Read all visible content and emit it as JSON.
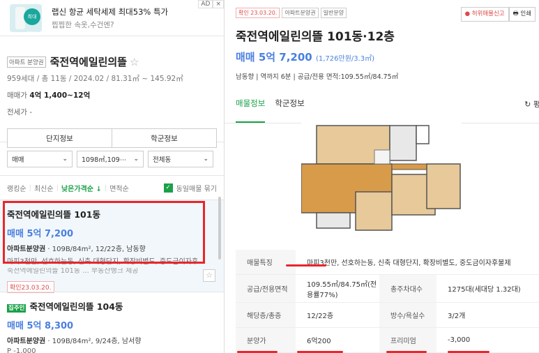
{
  "ad": {
    "title": "랩신 항균 세탁세제 최대53% 특가",
    "subtitle": "찝찝한 속옷,수건엔?",
    "badge": "최대53%",
    "ad_label": "AD",
    "close": "×"
  },
  "complex": {
    "tag": "아파트 분양권",
    "name": "죽전역에일린의뜰",
    "star": "☆",
    "meta": "959세대 / 총 11동 / 2024.02 / 81.31㎡ ~ 145.92㎡",
    "sale_label": "매매가",
    "sale_value": "4억 1,400~12억",
    "jeonse_label": "전세가",
    "jeonse_value": "-",
    "btn_complex": "단지정보",
    "btn_school": "학군정보"
  },
  "filters": {
    "type": "매매",
    "area": "1098㎡,109⋯",
    "dong": "전체동"
  },
  "sort": {
    "items": [
      "랭킹순",
      "최신순"
    ],
    "active": "낮은가격순 ↓",
    "last": "면적순",
    "group_label": "동일매물 묶기",
    "check": "✓"
  },
  "listings": [
    {
      "name": "죽전역에일린의뜰 101동",
      "price": "매매 5억 7,200",
      "info_type": "아파트분양권",
      "info": " · 109B/84m², 12/22층, 남동향",
      "desc": "마피3천만, 선호하는동, 신축 대형단지, 확장비별도, 중도금이자후",
      "desc2": "죽전역에일린의뜰 101동 ... 부동산뱅크 제공",
      "confirm": "확인23.03.20.",
      "fav": "☆"
    },
    {
      "owner": "집주인",
      "name": "죽전역에일린의뜰 104동",
      "price": "매매 5억 8,300",
      "info_type": "아파트분양권",
      "info": " · 109B/84m², 9/24층, 남서향",
      "desc": "P -1,000"
    }
  ],
  "detail": {
    "tags": [
      "확인 23.03.20.",
      "아파트분양권",
      "일반분양"
    ],
    "report": "● 허위매물신고",
    "print": "🖶 인쇄",
    "title": "죽전역에일린의뜰 101동·12층",
    "price": "매매 5억 7,200",
    "price_unit": "(1,726만원/3.3㎡)",
    "meta": "남동향  |  역까지 6분  |  공급/전용 면적:109.55㎡/84.75㎡",
    "tabs": [
      "매물정보",
      "학군정보"
    ],
    "refresh": "↻ 평",
    "table": [
      {
        "k": "매물특징",
        "v": "마피3천만, 선호하는동, 신축 대형단지, 확장비별도, 중도금이자후불제"
      },
      {
        "k": "공급/전용면적",
        "v": "109.55㎡/84.75㎡(전용률77%)",
        "k2": "총주차대수",
        "v2": "1275대(세대당 1.32대)"
      },
      {
        "k": "해당층/총층",
        "v": "12/22층",
        "k2": "방수/욕실수",
        "v2": "3/2개"
      },
      {
        "k": "분양가",
        "v": "6억200",
        "k2": "프리미엄",
        "v2": "-3,000"
      }
    ]
  }
}
